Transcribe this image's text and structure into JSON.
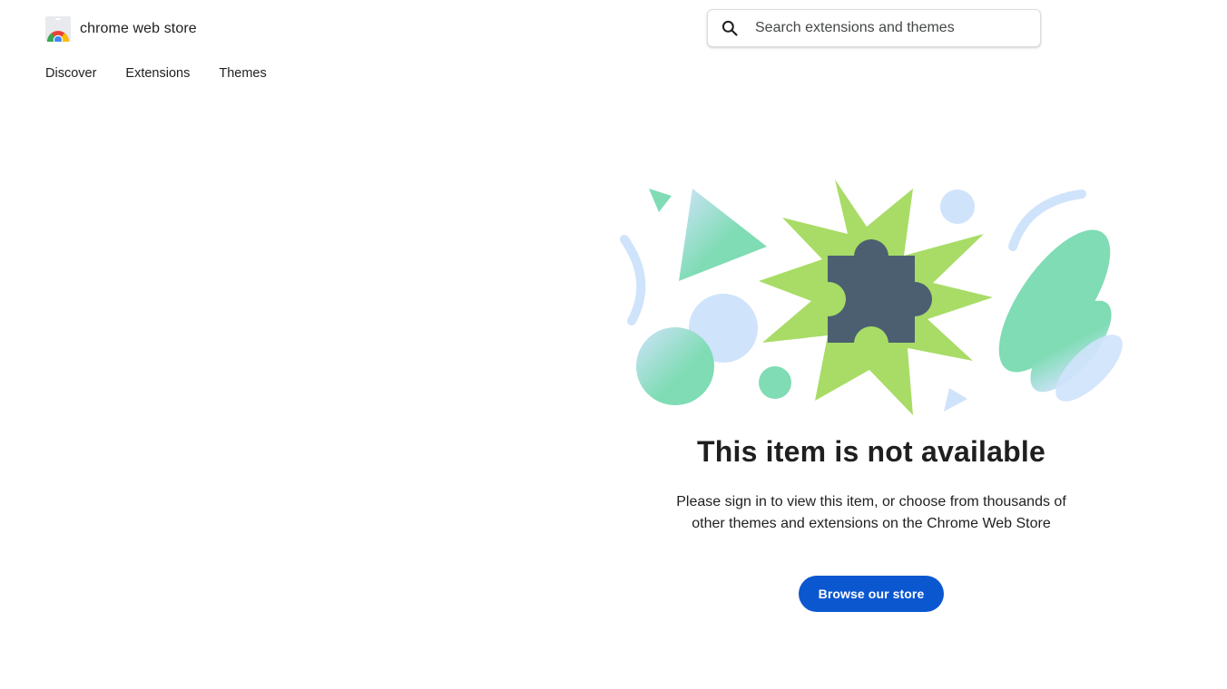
{
  "header": {
    "brand_name": "chrome web store",
    "brand_icon": "chrome-web-store-logo",
    "search": {
      "placeholder": "Search extensions and themes",
      "value": "",
      "icon": "search-icon"
    }
  },
  "nav": {
    "items": [
      {
        "label": "Discover"
      },
      {
        "label": "Extensions"
      },
      {
        "label": "Themes"
      }
    ]
  },
  "main": {
    "illustration_icon": "puzzle-piece-icon",
    "title": "This item is not available",
    "message_line1": "Please sign in to view this item, or choose from thousands of",
    "message_line2": "other themes and extensions on the Chrome Web Store",
    "cta_label": "Browse our store"
  },
  "colors": {
    "accent": "#0b57d0",
    "starburst": "#a8dc66",
    "puzzle": "#4b5f71",
    "mint": "#7fdcb4",
    "light_blue": "#cfe3fb"
  }
}
